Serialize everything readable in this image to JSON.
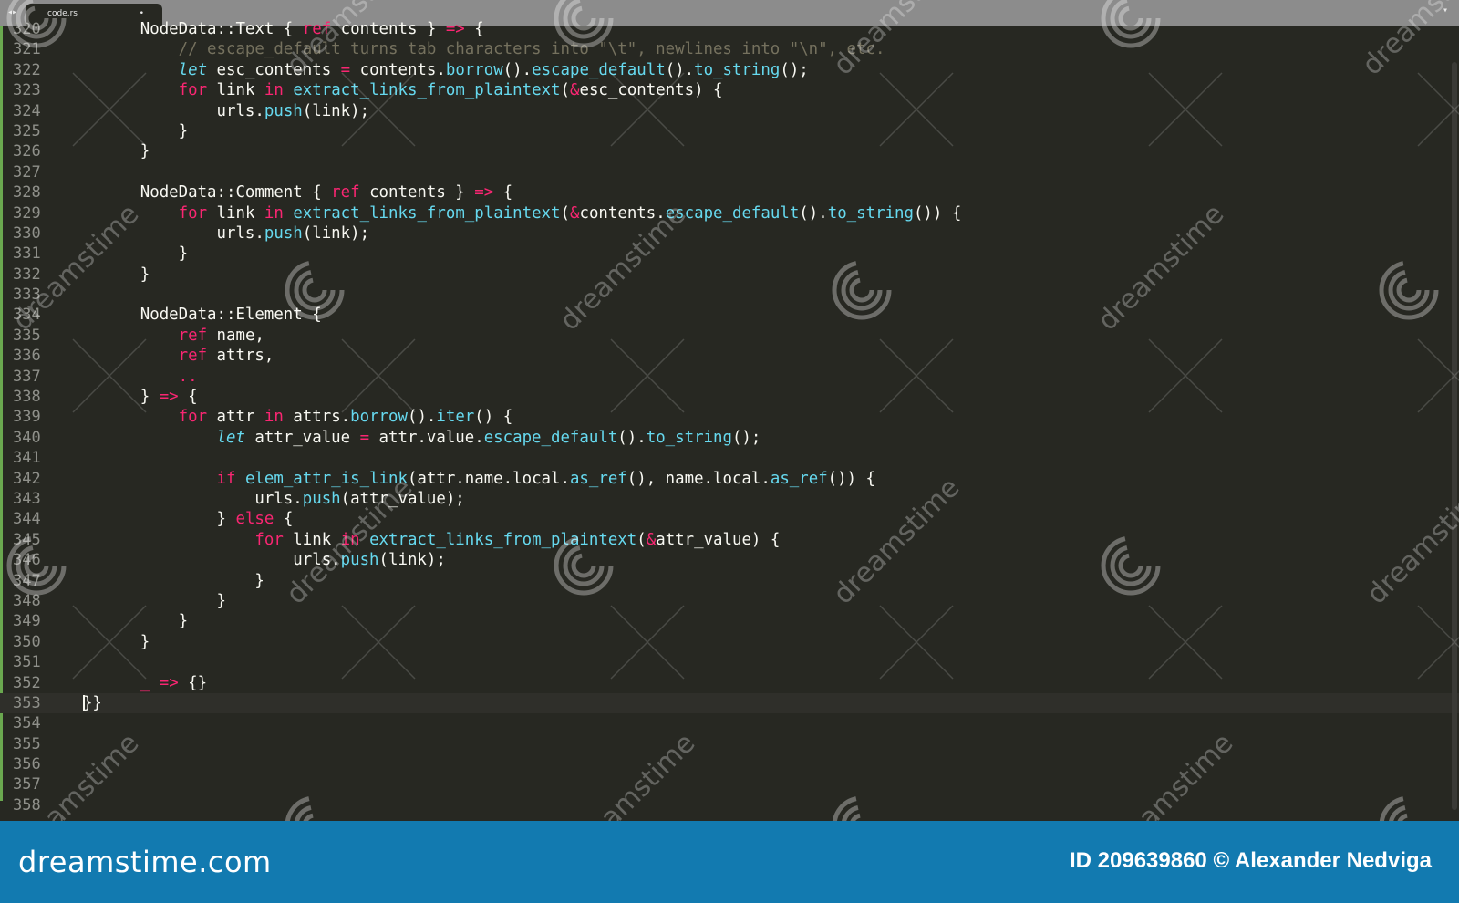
{
  "tab": {
    "title": "code.rs",
    "dot": "•",
    "nav": "◂▸"
  },
  "current_line_number": "353",
  "line_numbers": [
    "320",
    "321",
    "322",
    "323",
    "324",
    "325",
    "326",
    "327",
    "328",
    "329",
    "330",
    "331",
    "332",
    "333",
    "334",
    "335",
    "336",
    "337",
    "338",
    "339",
    "340",
    "341",
    "342",
    "343",
    "344",
    "345",
    "346",
    "347",
    "348",
    "349",
    "350",
    "351",
    "352",
    "353",
    "354",
    "355",
    "356",
    "357",
    "358"
  ],
  "code_lines": [
    [
      [
        "",
        "        NodeData::Text { "
      ],
      [
        "k",
        "ref"
      ],
      [
        "",
        " contents } "
      ],
      [
        "k",
        "=>"
      ],
      [
        "",
        " {"
      ]
    ],
    [
      [
        "c",
        "            // escape_default turns tab characters into \"\\t\", newlines into \"\\n\", etc."
      ]
    ],
    [
      [
        "i",
        "            let"
      ],
      [
        "",
        " esc_contents "
      ],
      [
        "k",
        "="
      ],
      [
        "",
        " contents."
      ],
      [
        "f",
        "borrow"
      ],
      [
        "",
        "()."
      ],
      [
        "f",
        "escape_default"
      ],
      [
        "",
        "()."
      ],
      [
        "f",
        "to_string"
      ],
      [
        "",
        "();"
      ]
    ],
    [
      [
        "k",
        "            for"
      ],
      [
        "",
        " link "
      ],
      [
        "k",
        "in"
      ],
      [
        "",
        " "
      ],
      [
        "f",
        "extract_links_from_plaintext"
      ],
      [
        "",
        "("
      ],
      [
        "k",
        "&"
      ],
      [
        "",
        "esc_contents) {"
      ]
    ],
    [
      [
        "",
        "                urls."
      ],
      [
        "f",
        "push"
      ],
      [
        "",
        "(link);"
      ]
    ],
    [
      [
        "",
        "            }"
      ]
    ],
    [
      [
        "",
        "        }"
      ]
    ],
    [
      [
        "",
        ""
      ]
    ],
    [
      [
        "",
        "        NodeData::Comment { "
      ],
      [
        "k",
        "ref"
      ],
      [
        "",
        " contents } "
      ],
      [
        "k",
        "=>"
      ],
      [
        "",
        " {"
      ]
    ],
    [
      [
        "k",
        "            for"
      ],
      [
        "",
        " link "
      ],
      [
        "k",
        "in"
      ],
      [
        "",
        " "
      ],
      [
        "f",
        "extract_links_from_plaintext"
      ],
      [
        "",
        "("
      ],
      [
        "k",
        "&"
      ],
      [
        "",
        "contents."
      ],
      [
        "f",
        "escape_default"
      ],
      [
        "",
        "()."
      ],
      [
        "f",
        "to_string"
      ],
      [
        "",
        "()) {"
      ]
    ],
    [
      [
        "",
        "                urls."
      ],
      [
        "f",
        "push"
      ],
      [
        "",
        "(link);"
      ]
    ],
    [
      [
        "",
        "            }"
      ]
    ],
    [
      [
        "",
        "        }"
      ]
    ],
    [
      [
        "",
        ""
      ]
    ],
    [
      [
        "",
        "        NodeData::Element {"
      ]
    ],
    [
      [
        "k",
        "            ref"
      ],
      [
        "",
        " name,"
      ]
    ],
    [
      [
        "k",
        "            ref"
      ],
      [
        "",
        " attrs,"
      ]
    ],
    [
      [
        "k",
        "            .."
      ]
    ],
    [
      [
        "",
        "        } "
      ],
      [
        "k",
        "=>"
      ],
      [
        "",
        " {"
      ]
    ],
    [
      [
        "k",
        "            for"
      ],
      [
        "",
        " attr "
      ],
      [
        "k",
        "in"
      ],
      [
        "",
        " attrs."
      ],
      [
        "f",
        "borrow"
      ],
      [
        "",
        "()."
      ],
      [
        "f",
        "iter"
      ],
      [
        "",
        "() {"
      ]
    ],
    [
      [
        "i",
        "                let"
      ],
      [
        "",
        " attr_value "
      ],
      [
        "k",
        "="
      ],
      [
        "",
        " attr.value."
      ],
      [
        "f",
        "escape_default"
      ],
      [
        "",
        "()."
      ],
      [
        "f",
        "to_string"
      ],
      [
        "",
        "();"
      ]
    ],
    [
      [
        "",
        ""
      ]
    ],
    [
      [
        "k",
        "                if"
      ],
      [
        "",
        " "
      ],
      [
        "f",
        "elem_attr_is_link"
      ],
      [
        "",
        "(attr.name.local."
      ],
      [
        "f",
        "as_ref"
      ],
      [
        "",
        "(), name.local."
      ],
      [
        "f",
        "as_ref"
      ],
      [
        "",
        "()) {"
      ]
    ],
    [
      [
        "",
        "                    urls."
      ],
      [
        "f",
        "push"
      ],
      [
        "",
        "(attr_value);"
      ]
    ],
    [
      [
        "",
        "                } "
      ],
      [
        "k",
        "else"
      ],
      [
        "",
        " {"
      ]
    ],
    [
      [
        "k",
        "                    for"
      ],
      [
        "",
        " link "
      ],
      [
        "k",
        "in"
      ],
      [
        "",
        " "
      ],
      [
        "f",
        "extract_links_from_plaintext"
      ],
      [
        "",
        "("
      ],
      [
        "k",
        "&"
      ],
      [
        "",
        "attr_value) {"
      ]
    ],
    [
      [
        "",
        "                        urls."
      ],
      [
        "f",
        "push"
      ],
      [
        "",
        "(link);"
      ]
    ],
    [
      [
        "",
        "                    }"
      ]
    ],
    [
      [
        "",
        "                }"
      ]
    ],
    [
      [
        "",
        "            }"
      ]
    ],
    [
      [
        "",
        "        }"
      ]
    ],
    [
      [
        "",
        ""
      ]
    ],
    [
      [
        "k",
        "        _"
      ],
      [
        "",
        " "
      ],
      [
        "k",
        "=>"
      ],
      [
        "",
        " {}"
      ]
    ],
    [
      [
        "",
        "  "
      ],
      [
        "caret",
        ""
      ],
      [
        "",
        "}}"
      ]
    ],
    [
      [
        "",
        ""
      ]
    ],
    [
      [
        "",
        ""
      ]
    ],
    [
      [
        "",
        ""
      ]
    ],
    [
      [
        "",
        ""
      ]
    ],
    [
      [
        "",
        ""
      ]
    ]
  ],
  "watermark": {
    "text": "dreamstime",
    "color": "#ffffff"
  },
  "footer": {
    "brand": "dreamstime.com",
    "credit": "ID 209639860 © Alexander Nedviga",
    "background": "#127ab0"
  },
  "colors": {
    "background": "#272822",
    "keyword": "#f92672",
    "function": "#66d9ef",
    "comment": "#75715e",
    "text": "#f8f8f2",
    "line_number": "#8f908a",
    "gutter_marker": "#6aa84f"
  }
}
